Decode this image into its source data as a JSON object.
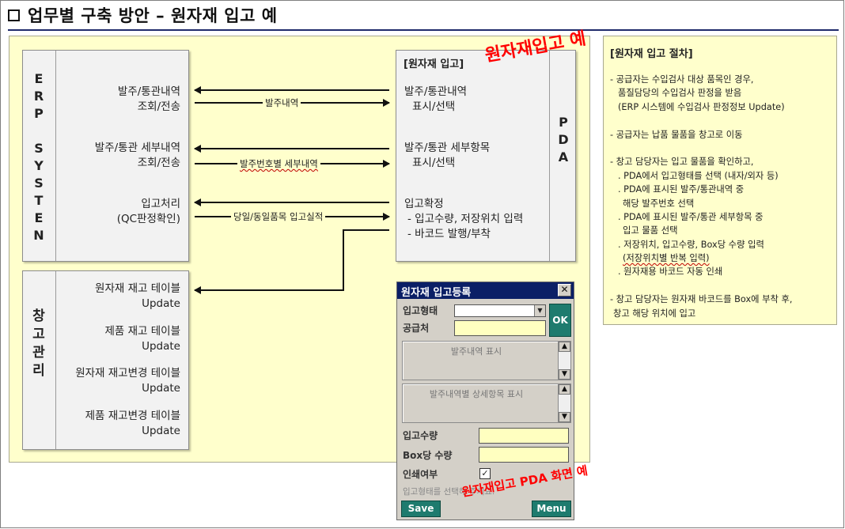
{
  "title": "업무별 구축 방안 – 원자재 입고 예",
  "erp": {
    "label": [
      "E",
      "R",
      "P",
      "",
      "S",
      "Y",
      "S",
      "T",
      "E",
      "N"
    ],
    "items": [
      {
        "line1": "발주/통관내역",
        "line2": "조회/전송"
      },
      {
        "line1": "발주/통관 세부내역",
        "line2": "조회/전송"
      },
      {
        "line1": "입고처리",
        "line2": "(QC판정확인)"
      }
    ]
  },
  "warehouse": {
    "label": [
      "창",
      "고",
      "관",
      "리"
    ],
    "items": [
      {
        "line1": "원자재 재고 테이블",
        "line2": "Update"
      },
      {
        "line1": "제품 재고 테이블",
        "line2": "Update"
      },
      {
        "line1": "원자재 재고변경 테이블",
        "line2": "Update"
      },
      {
        "line1": "제품 재고변경 테이블",
        "line2": "Update"
      }
    ]
  },
  "flows": {
    "f1": "발주내역",
    "f2": "발주번호별 세부내역",
    "f3": "당일/동일품목 입고실적"
  },
  "pda_panel": {
    "header": "[원자재 입고]",
    "side_label": [
      "P",
      "D",
      "A"
    ],
    "items": [
      {
        "line1": "발주/통관내역",
        "line2": "표시/선택"
      },
      {
        "line1": "발주/통관 세부항목",
        "line2": "표시/선택"
      },
      {
        "line1": "입고확정",
        "line2": "- 입고수량, 저장위치 입력",
        "line3": "- 바코드 발행/부착"
      }
    ]
  },
  "annotations": {
    "a1": "원자재입고 예",
    "a2": "원자재입고 PDA 화면 예"
  },
  "procedure": {
    "title": "[원자재 입고 절차]",
    "lines": [
      "- 공급자는 수입검사 대상 품목인 경우,",
      "   품질담당의 수입검사 판정을 받음",
      "   (ERP 시스템에 수입검사 판정정보 Update)",
      "",
      "- 공급자는 납품 물품을 창고로 이동",
      "",
      "- 창고 담당자는 입고 물품을 확인하고,",
      "   . PDA에서 입고형태를 선택 (내자/외자 등)",
      "   . PDA에 표시된 발주/통관내역 중",
      "     해당 발주번호 선택",
      "   . PDA에 표시된 발주/통관 세부항목 중",
      "     입고 물품 선택",
      "   . 저장위치, 입고수량, Box당 수량 입력",
      "     (저장위치별 반복 입력)",
      "   . 원자재용 바코드 자동 인쇄",
      "",
      "- 창고 담당자는 원자재 바코드를 Box에 부착 후,",
      "  창고 해당 위치에 입고"
    ]
  },
  "pda_screen": {
    "title": "원자재 입고등록",
    "close": "✕",
    "type_label": "입고형태",
    "supplier_label": "공급처",
    "ok": "OK",
    "list1": "발주내역 표시",
    "list2": "발주내역별 상세항목 표시",
    "qty_label": "입고수량",
    "box_label": "Box당 수량",
    "print_label": "인쇄여부",
    "hint": "입고형태를 선택해 주세요.",
    "save": "Save",
    "menu": "Menu"
  }
}
